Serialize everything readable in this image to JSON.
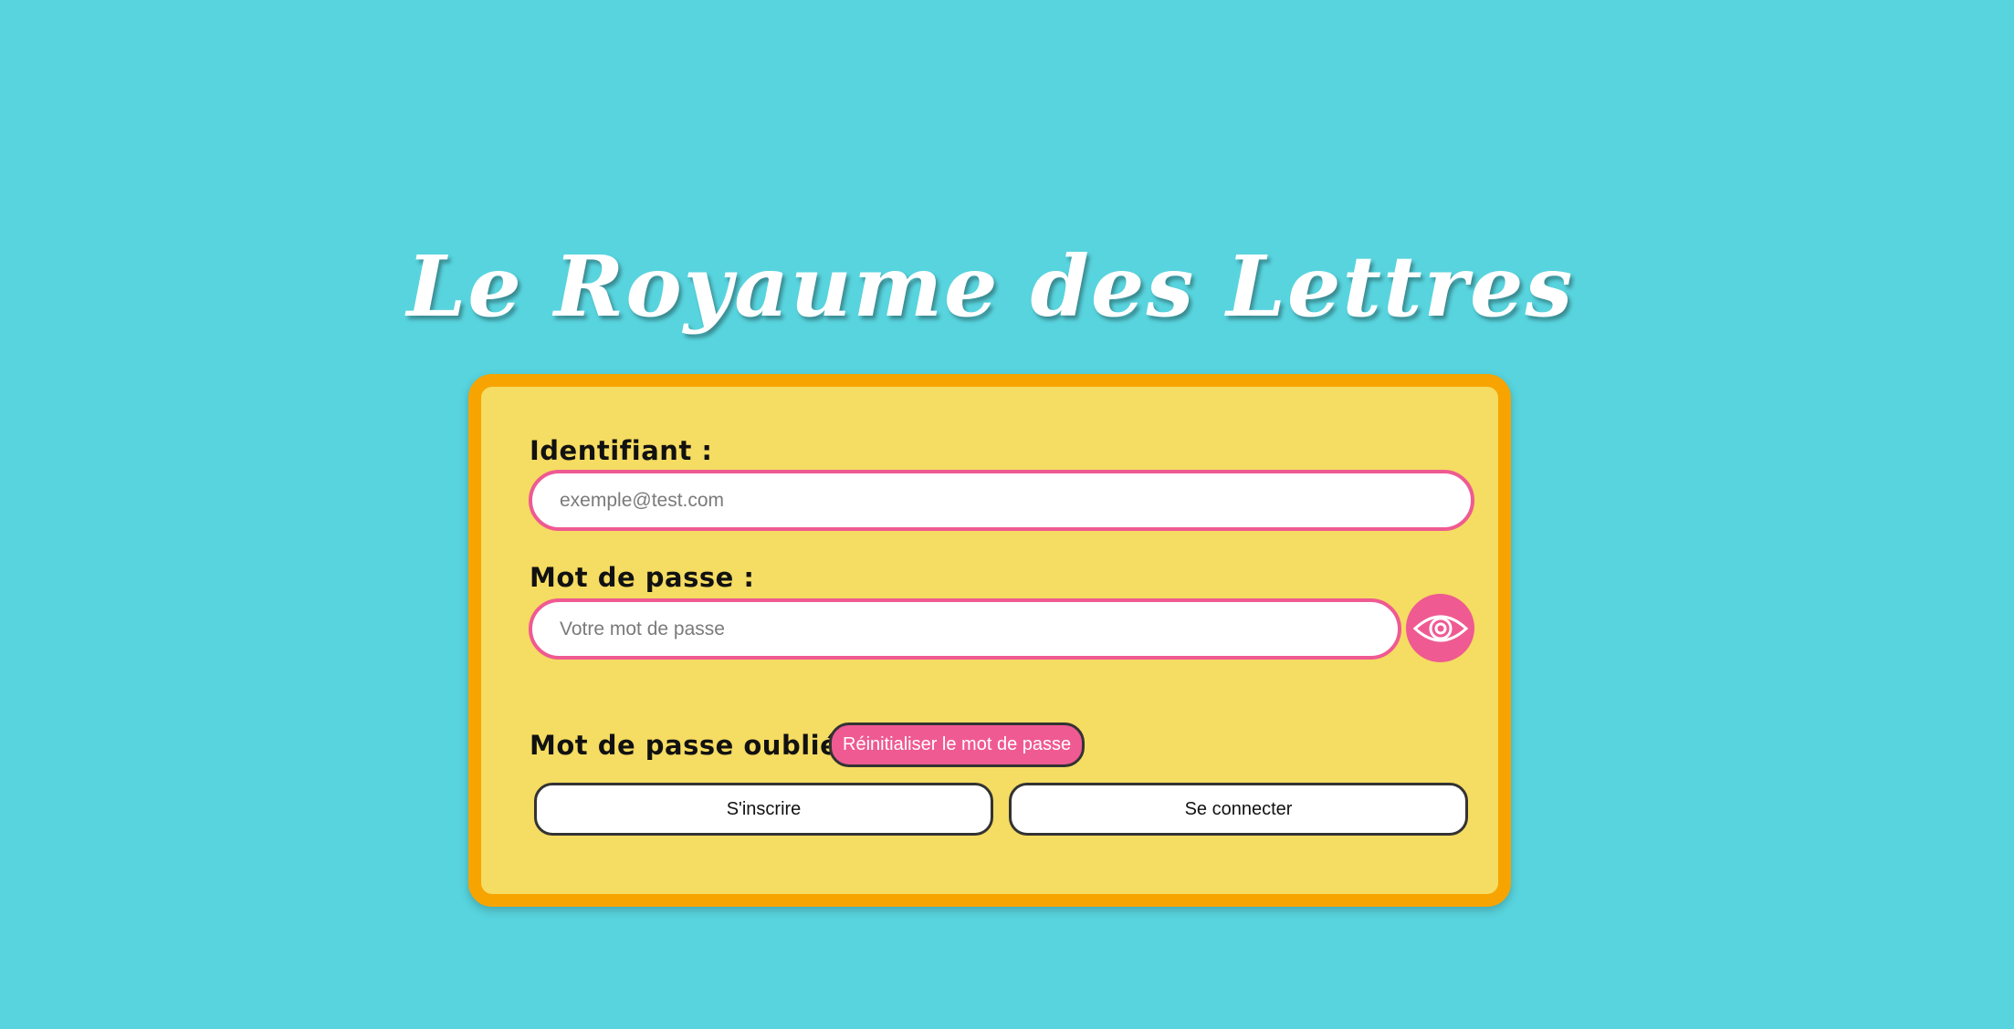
{
  "app": {
    "title": "Le Royaume des Lettres"
  },
  "login_form": {
    "username_label": "Identifiant :",
    "username_placeholder": "exemple@test.com",
    "username_value": "",
    "password_label": "Mot de passe :",
    "password_placeholder": "Votre mot de passe",
    "password_value": "",
    "toggle_visibility_icon": "eye-icon",
    "forgot_label": "Mot de passe oublié ?",
    "reset_button_label": "Réinitialiser le mot de passe",
    "register_button_label": "S'inscrire",
    "login_button_label": "Se connecter"
  },
  "colors": {
    "background": "#58d4de",
    "card_fill": "#f5dc62",
    "card_border": "#f7a400",
    "accent_pink": "#ef5a92",
    "title_text": "#ffffff"
  }
}
